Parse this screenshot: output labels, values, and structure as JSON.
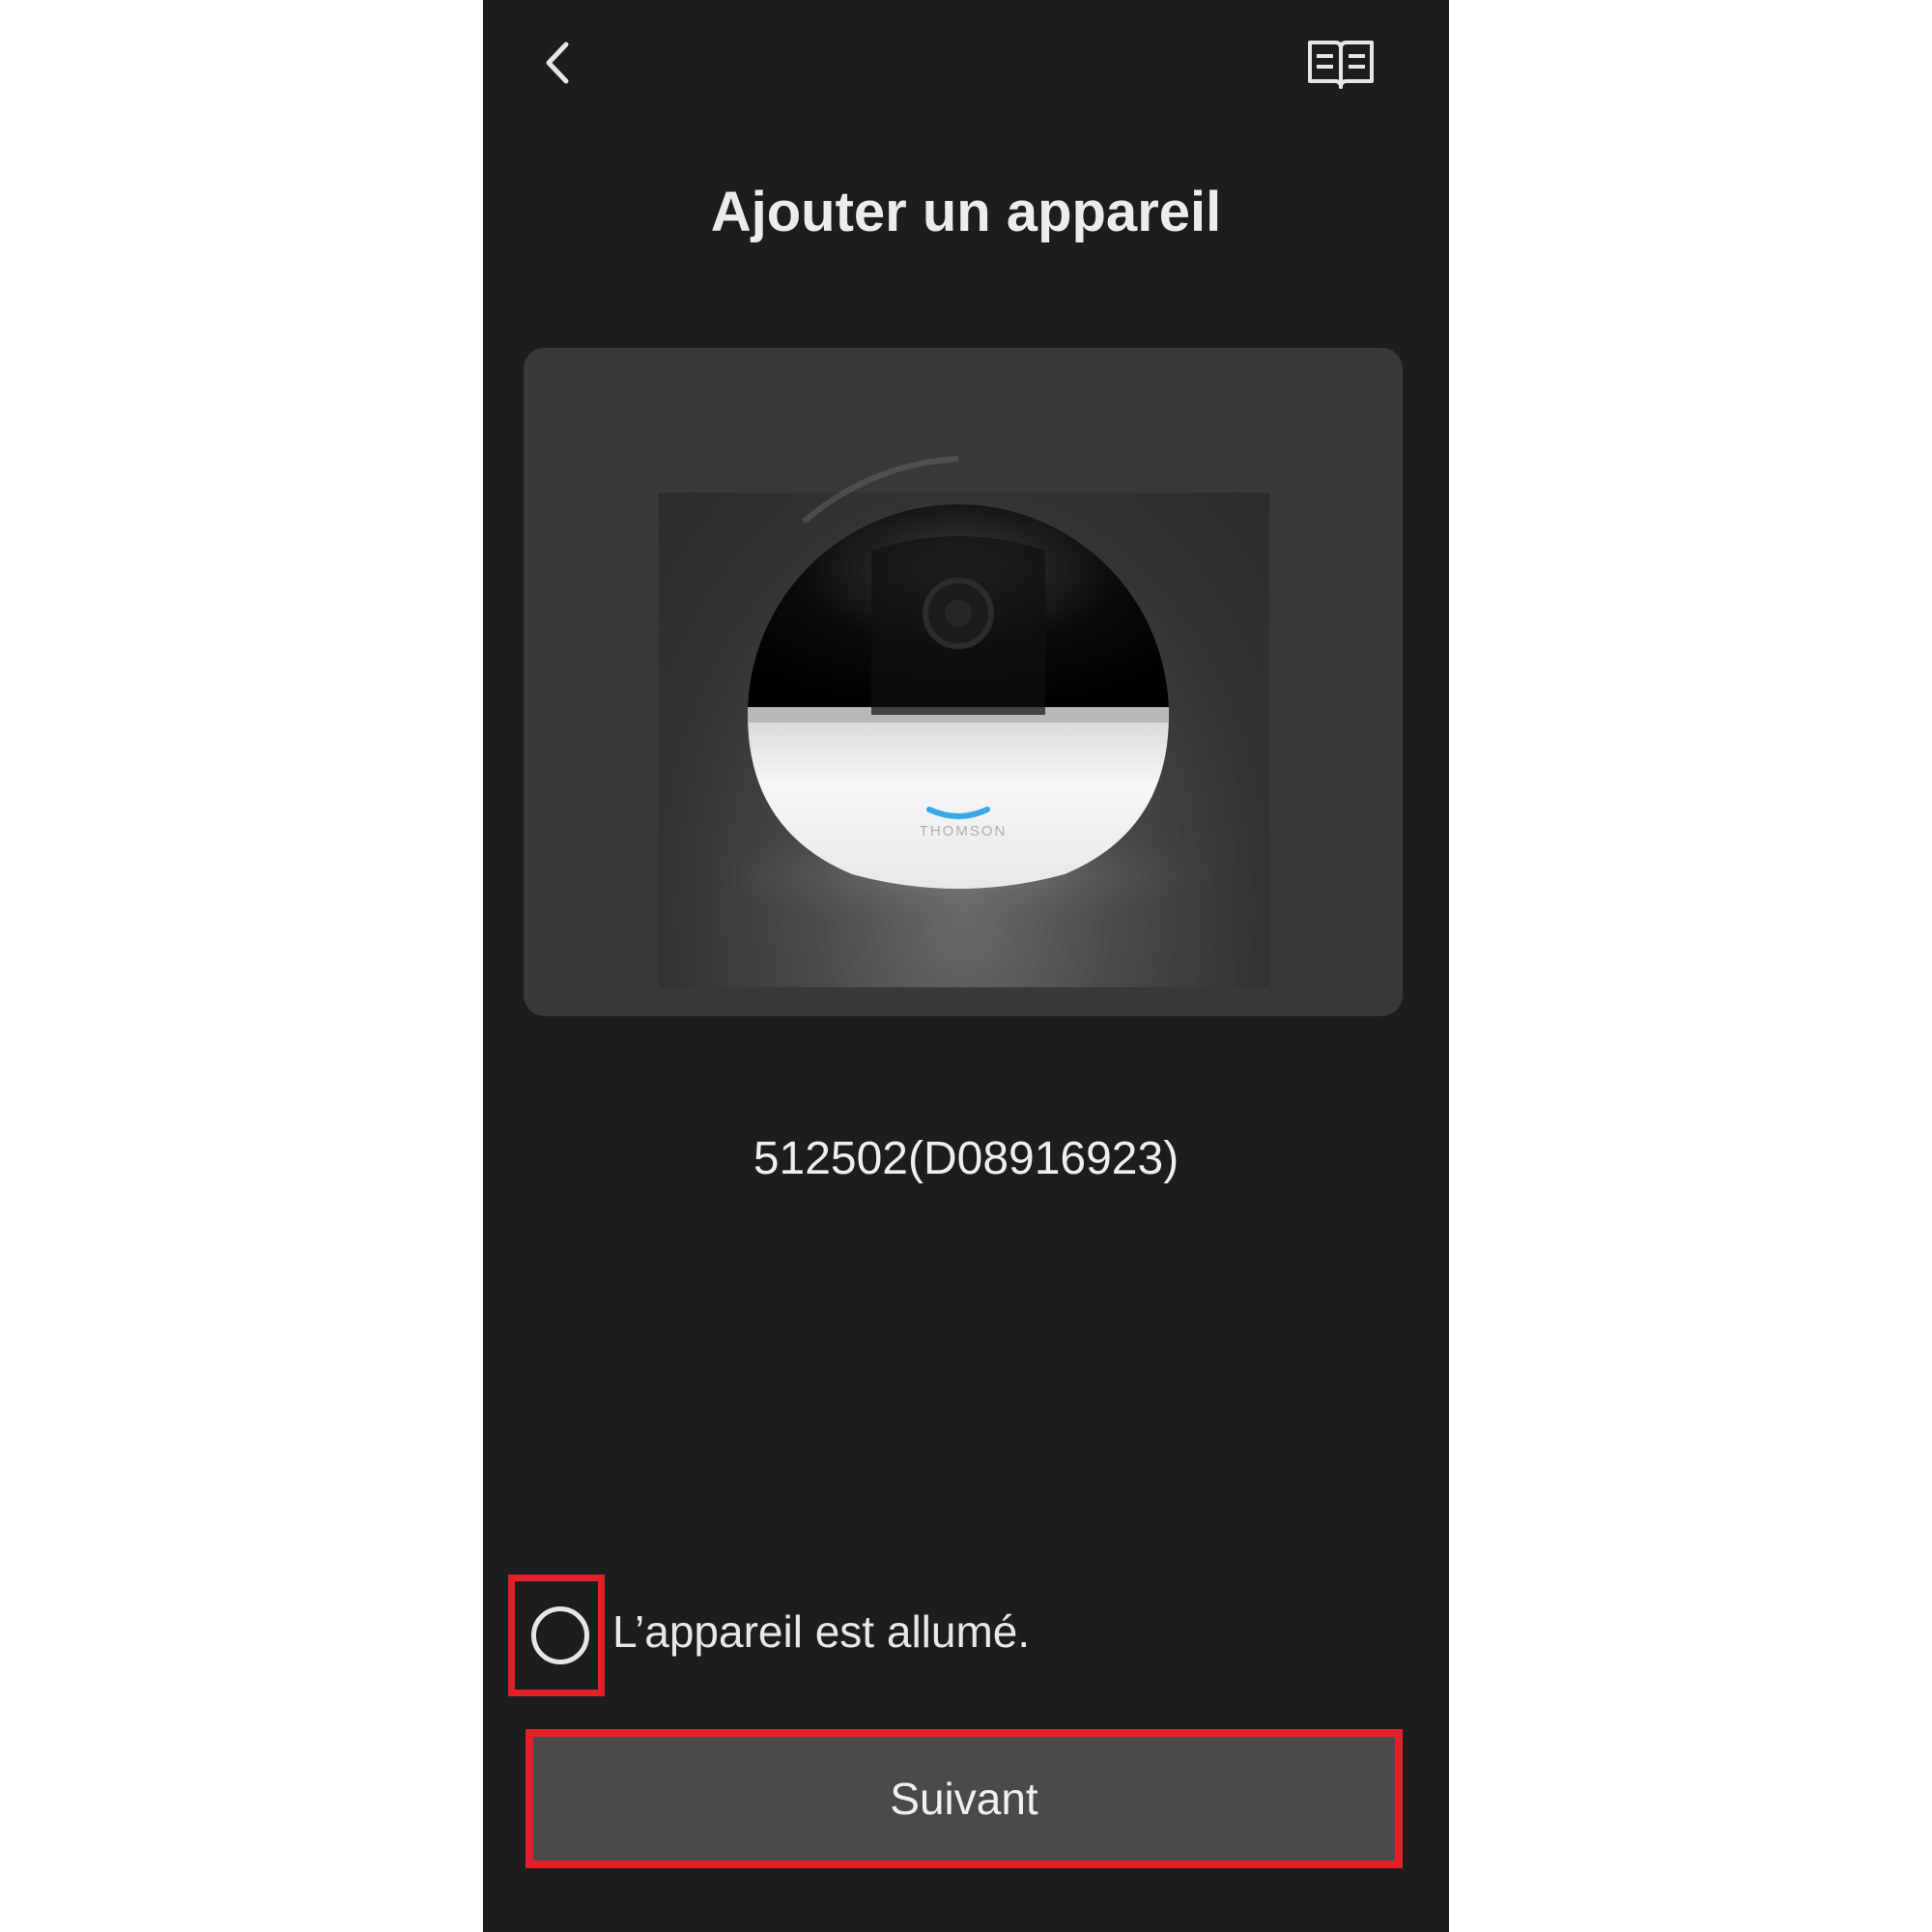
{
  "header": {
    "back_icon": "chevron-left-icon",
    "manual_icon": "open-book-icon",
    "title": "Ajouter un appareil"
  },
  "device": {
    "image_icon": "dome-camera-icon",
    "brand": "THOMSON",
    "name": "512502(D08916923)"
  },
  "confirmation": {
    "checked": false,
    "label": "L’appareil est allumé."
  },
  "actions": {
    "next_label": "Suivant"
  },
  "colors": {
    "background": "#1d1d1e",
    "card": "#393939",
    "button": "#4a4a4c",
    "highlight": "#e3202a",
    "camera_light": "#39a9e6"
  }
}
